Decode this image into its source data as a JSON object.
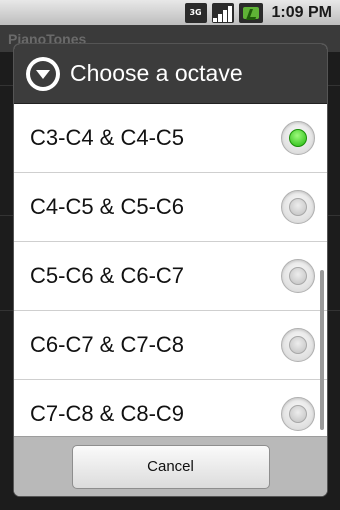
{
  "status_bar": {
    "network": "3G",
    "time": "1:09 PM",
    "icons": [
      "3g-icon",
      "signal-icon",
      "battery-charging-icon"
    ]
  },
  "background_app": {
    "title": "PianoTones"
  },
  "dialog": {
    "title": "Choose a octave",
    "options": [
      {
        "label": "C3-C4 & C4-C5",
        "selected": true
      },
      {
        "label": "C4-C5 & C5-C6",
        "selected": false
      },
      {
        "label": "C5-C6 & C6-C7",
        "selected": false
      },
      {
        "label": "C6-C7 & C7-C8",
        "selected": false
      },
      {
        "label": "C7-C8 & C8-C9",
        "selected": false
      }
    ],
    "cancel_label": "Cancel",
    "accent_color": "#20b80b"
  }
}
